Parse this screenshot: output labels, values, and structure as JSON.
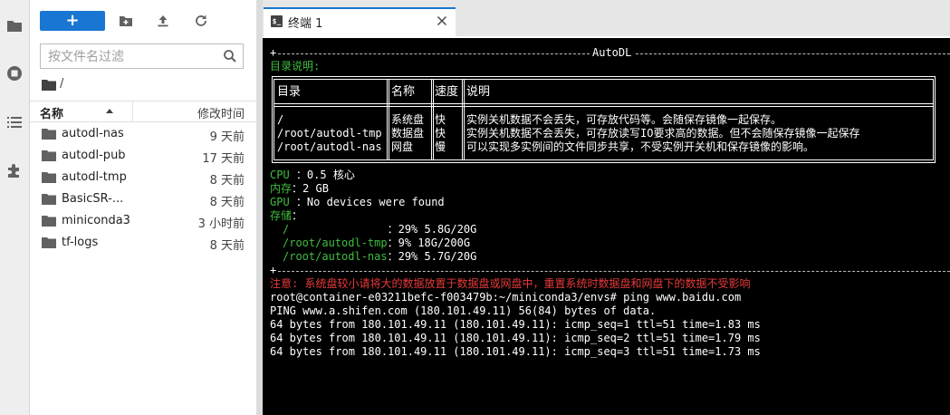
{
  "activity_bar": {
    "icons": [
      "folder-icon",
      "running-icon",
      "commands-icon",
      "extensions-icon"
    ]
  },
  "file_browser": {
    "toolbar": {
      "new_label": "+",
      "icons": [
        "new-folder-icon",
        "upload-icon",
        "refresh-icon"
      ]
    },
    "filter": {
      "placeholder": "按文件名过滤",
      "value": ""
    },
    "breadcrumb": {
      "path": "/"
    },
    "columns": {
      "name": "名称",
      "modified": "修改时间"
    },
    "files": [
      {
        "name": "autodl-nas",
        "modified": "9 天前"
      },
      {
        "name": "autodl-pub",
        "modified": "17 天前"
      },
      {
        "name": "autodl-tmp",
        "modified": "8 天前"
      },
      {
        "name": "BasicSR-...",
        "modified": "8 天前"
      },
      {
        "name": "miniconda3",
        "modified": "3 小时前"
      },
      {
        "name": "tf-logs",
        "modified": "8 天前"
      }
    ]
  },
  "tabs": [
    {
      "label": "终端 1",
      "icon": "terminal-icon"
    }
  ],
  "terminal": {
    "banner_title": "AutoDL",
    "dir_heading": "目录说明:",
    "table": {
      "headers": [
        "目录",
        "名称",
        "速度",
        "说明"
      ],
      "rows": [
        [
          "/",
          "系统盘",
          "快",
          "实例关机数据不会丢失，可存放代码等。会随保存镜像一起保存。"
        ],
        [
          "/root/autodl-tmp",
          "数据盘",
          "快",
          "实例关机数据不会丢失，可存放读写IO要求高的数据。但不会随保存镜像一起保存"
        ],
        [
          "/root/autodl-nas",
          "网盘",
          "慢",
          "可以实现多实例间的文件同步共享，不受实例开关机和保存镜像的影响。"
        ]
      ]
    },
    "info": [
      {
        "key": "CPU ",
        "sep": "：",
        "value": "0.5 核心"
      },
      {
        "key": "内存",
        "sep": "：",
        "value": "2 GB"
      },
      {
        "key": "GPU ",
        "sep": "：",
        "value": "No devices were found"
      },
      {
        "key": "存储",
        "sep": "：",
        "value": ""
      }
    ],
    "storage": [
      {
        "path": "/               ",
        "sep": "：",
        "value": "29% 5.8G/20G"
      },
      {
        "path": "/root/autodl-tmp",
        "sep": "：",
        "value": "9% 18G/200G"
      },
      {
        "path": "/root/autodl-nas",
        "sep": "：",
        "value": "29% 5.7G/20G"
      }
    ],
    "warning": "注意: 系统盘较小请将大的数据放置于数据盘或网盘中，重置系统时数据盘和网盘下的数据不受影响",
    "output": [
      "root@container-e03211befc-f003479b:~/miniconda3/envs# ping www.baidu.com",
      "PING www.a.shifen.com (180.101.49.11) 56(84) bytes of data.",
      "64 bytes from 180.101.49.11 (180.101.49.11): icmp_seq=1 ttl=51 time=1.83 ms",
      "64 bytes from 180.101.49.11 (180.101.49.11): icmp_seq=2 ttl=51 time=1.79 ms",
      "64 bytes from 180.101.49.11 (180.101.49.11): icmp_seq=3 ttl=51 time=1.73 ms"
    ]
  },
  "colors": {
    "accent": "#1976d2",
    "terminal_bg": "#000000",
    "terminal_green": "#3fbf3f",
    "terminal_red": "#e83a3a"
  }
}
